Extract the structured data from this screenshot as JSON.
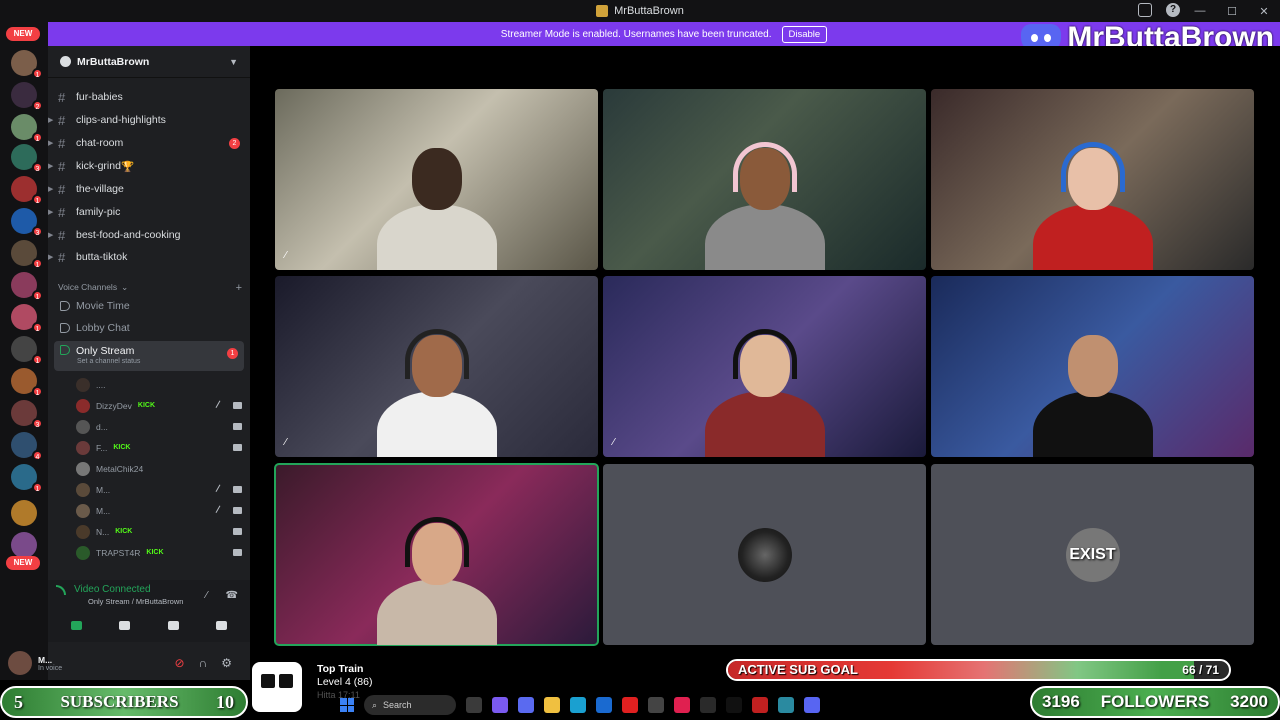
{
  "titlebar": {
    "title": "MrButtaBrown"
  },
  "banner": {
    "text": "Streamer Mode is enabled. Usernames have been truncated.",
    "button": "Disable"
  },
  "brand": {
    "name": "MrButtaBrown"
  },
  "rail": {
    "new_top": "NEW",
    "new_bottom": "NEW",
    "counts": [
      "1",
      "2",
      "1",
      "3",
      "1",
      "3",
      "1",
      "1",
      "1",
      "1",
      "1",
      "3",
      "4",
      "1"
    ]
  },
  "server": {
    "name": "MrButtaBrown"
  },
  "channels": [
    {
      "name": "fur-babies",
      "arrow": false,
      "badge": ""
    },
    {
      "name": "clips-and-highlights",
      "arrow": true,
      "badge": ""
    },
    {
      "name": "chat-room",
      "arrow": true,
      "badge": "2"
    },
    {
      "name": "kick-grind",
      "arrow": true,
      "badge": "",
      "emoji": "🏆"
    },
    {
      "name": "the-village",
      "arrow": true,
      "badge": ""
    },
    {
      "name": "family-pic",
      "arrow": true,
      "badge": ""
    },
    {
      "name": "best-food-and-cooking",
      "arrow": true,
      "badge": ""
    },
    {
      "name": "butta-tiktok",
      "arrow": true,
      "badge": ""
    }
  ],
  "voice_section": {
    "label": "Voice Channels",
    "plus": "+"
  },
  "voice_channels": [
    {
      "name": "Movie Time"
    },
    {
      "name": "Lobby Chat"
    },
    {
      "name": "Only Stream",
      "status_hint": "Set a channel status",
      "badge": "1"
    }
  ],
  "members": [
    {
      "name": "....",
      "kick": "",
      "muted": false,
      "cam": false
    },
    {
      "name": "DizzyDev",
      "kick": "KICK",
      "muted": true,
      "cam": true
    },
    {
      "name": "d...",
      "kick": "",
      "muted": false,
      "cam": true
    },
    {
      "name": "F...",
      "kick": "KICK",
      "muted": false,
      "cam": true
    },
    {
      "name": "MetalChik24",
      "kick": "",
      "muted": false,
      "cam": false
    },
    {
      "name": "M...",
      "kick": "",
      "muted": true,
      "cam": true
    },
    {
      "name": "M...",
      "kick": "",
      "muted": true,
      "cam": true
    },
    {
      "name": "N...",
      "kick": "KICK",
      "muted": false,
      "cam": true
    },
    {
      "name": "TRAPST4R",
      "kick": "KICK",
      "muted": false,
      "cam": true
    }
  ],
  "voice_connection": {
    "title": "Video Connected",
    "subtitle": "Only Stream / MrButtaBrown"
  },
  "user": {
    "name": "M...",
    "status": "In voice"
  },
  "top_train": {
    "title": "Top Train",
    "level": "Level 4 (86)",
    "faded": "Hitta 17:11"
  },
  "sub_goal": {
    "label": "ACTIVE SUB GOAL",
    "count": "66 / 71",
    "progress": 0.93
  },
  "subscribers": {
    "current": "5",
    "label": "SUBSCRIBERS",
    "goal": "10"
  },
  "followers": {
    "current": "3196",
    "label": "FOLLOWERS",
    "goal": "3200"
  },
  "taskbar": {
    "search": "Search"
  },
  "tiles": [
    {
      "placeholder_text": "",
      "muted": true
    },
    {
      "placeholder_text": "",
      "muted": false
    },
    {
      "placeholder_text": "",
      "muted": false
    },
    {
      "placeholder_text": "",
      "muted": true
    },
    {
      "placeholder_text": "",
      "muted": true
    },
    {
      "placeholder_text": "",
      "muted": false
    },
    {
      "placeholder_text": "",
      "muted": false
    },
    {
      "placeholder_text": "",
      "muted": false
    },
    {
      "placeholder_text": "EXIST",
      "muted": false
    }
  ],
  "colors": {
    "accent": "#7c3aed",
    "speaking": "#23a55a",
    "alert": "#f23f43",
    "kick": "#53fc18"
  }
}
